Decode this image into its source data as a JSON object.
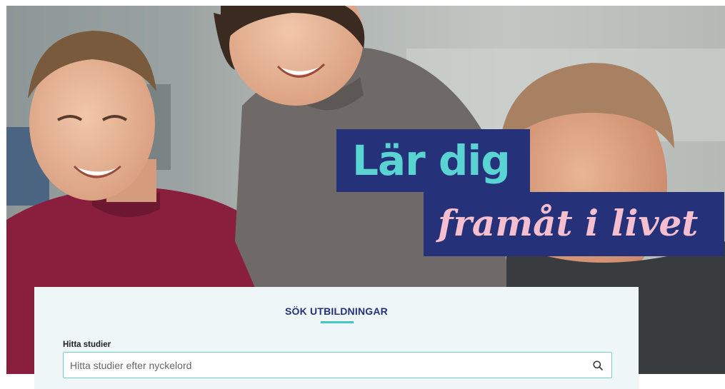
{
  "hero": {
    "tagline_line1": "Lär dig",
    "tagline_line2": "framåt i livet",
    "photo_icon": "hero-photo-three-smiling-students",
    "colors": {
      "banner_bg": "#253279",
      "line1_text": "#5ad3d3",
      "line2_text": "#f6bfcf"
    }
  },
  "search": {
    "heading": "SÖK UTBILDNINGAR",
    "field_label": "Hitta studier",
    "placeholder": "Hitta studier efter nyckelord",
    "value": "",
    "search_icon": "magnifier-icon",
    "accent_color": "#45c7c4"
  }
}
